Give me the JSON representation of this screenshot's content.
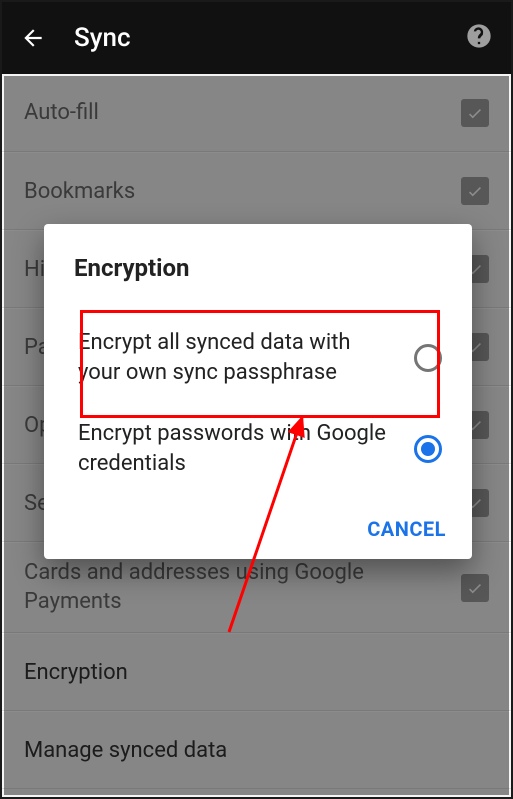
{
  "header": {
    "title": "Sync"
  },
  "settings": {
    "items": [
      {
        "label": "Auto-fill",
        "checked": true
      },
      {
        "label": "Bookmarks",
        "checked": true
      },
      {
        "label": "History",
        "checked": true
      },
      {
        "label": "Passwords",
        "checked": true
      },
      {
        "label": "Open Tabs",
        "checked": true
      },
      {
        "label": "Settings",
        "checked": true
      },
      {
        "label": "Cards and addresses using Google Payments",
        "checked": true
      }
    ],
    "dark_items": [
      {
        "label": "Encryption"
      },
      {
        "label": "Manage synced data"
      }
    ]
  },
  "dialog": {
    "title": "Encryption",
    "options": [
      {
        "label": "Encrypt all synced data with your own sync passphrase",
        "selected": false
      },
      {
        "label": "Encrypt passwords with Google credentials",
        "selected": true
      }
    ],
    "cancel": "CANCEL"
  }
}
